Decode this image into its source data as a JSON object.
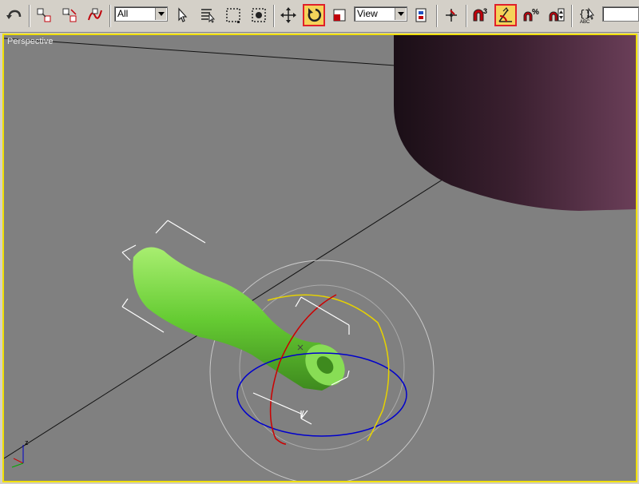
{
  "toolbar": {
    "selection_filter": {
      "selected": "All"
    },
    "coordinate_system": {
      "selected": "View"
    },
    "snap_labels": {
      "snap_3d": "3",
      "percent": "%"
    },
    "buttons": [
      {
        "name": "undo",
        "icon": "undo-arrow-icon"
      },
      {
        "name": "select-and-link",
        "icon": "select-link-icon"
      },
      {
        "name": "unlink-selection",
        "icon": "unlink-icon"
      },
      {
        "name": "bind-to-space-warp",
        "icon": "bind-space-warp-icon"
      },
      {
        "name": "select-object",
        "icon": "select-arrow-icon"
      },
      {
        "name": "select-by-name",
        "icon": "select-by-name-icon"
      },
      {
        "name": "rectangular-selection-region",
        "icon": "rect-selection-icon"
      },
      {
        "name": "window-crossing",
        "icon": "window-crossing-icon"
      },
      {
        "name": "select-and-move",
        "icon": "move-icon"
      },
      {
        "name": "select-and-rotate",
        "icon": "rotate-icon",
        "active": true
      },
      {
        "name": "select-and-scale",
        "icon": "scale-icon"
      },
      {
        "name": "use-pivot-point-center",
        "icon": "pivot-center-icon"
      },
      {
        "name": "select-and-manipulate",
        "icon": "manipulate-icon"
      },
      {
        "name": "snaps-toggle",
        "icon": "snap-magnet-icon"
      },
      {
        "name": "angle-snap-toggle",
        "icon": "angle-snap-icon",
        "active": true
      },
      {
        "name": "percent-snap-toggle",
        "icon": "percent-snap-icon"
      },
      {
        "name": "spinner-snap-toggle",
        "icon": "spinner-snap-icon"
      },
      {
        "name": "edit-named-selection-sets",
        "icon": "named-selection-icon"
      }
    ],
    "named_selection_field": ""
  },
  "viewport": {
    "label": "Perspective",
    "border_color": "#f0e000",
    "background_color": "#808080",
    "axis_tripod": {
      "label": "z"
    },
    "objects": [
      {
        "name": "bottle",
        "color": "#66cc33"
      },
      {
        "name": "cylinder",
        "color": "#5a3048"
      }
    ],
    "rotate_gizmo_colors": {
      "x": "#cc0000",
      "y": "#e6d200",
      "z": "#0000cc",
      "outer": "#c8c8c8"
    },
    "accent_active": "#f5d35a",
    "highlight_border": "#e0202a"
  }
}
